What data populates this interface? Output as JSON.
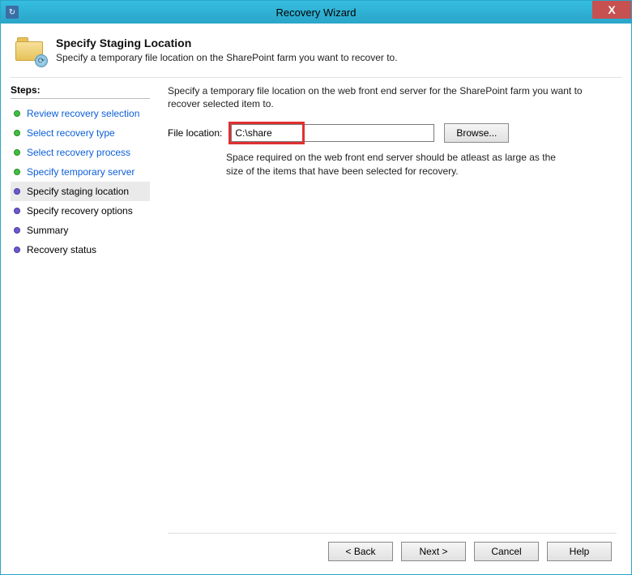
{
  "window": {
    "title": "Recovery Wizard"
  },
  "header": {
    "title": "Specify Staging Location",
    "subtitle": "Specify a temporary file location on the SharePoint farm you want to recover to."
  },
  "steps": {
    "title": "Steps:",
    "items": [
      {
        "label": "Review recovery selection",
        "state": "completed"
      },
      {
        "label": "Select recovery type",
        "state": "completed"
      },
      {
        "label": "Select recovery process",
        "state": "completed"
      },
      {
        "label": "Specify temporary server",
        "state": "completed"
      },
      {
        "label": "Specify staging location",
        "state": "current"
      },
      {
        "label": "Specify recovery options",
        "state": "future"
      },
      {
        "label": "Summary",
        "state": "future"
      },
      {
        "label": "Recovery status",
        "state": "future"
      }
    ]
  },
  "content": {
    "instruction": "Specify a temporary file location on the web front end server for the SharePoint farm you want to recover selected item to.",
    "file_location_label": "File location:",
    "file_location_value": "C:\\share",
    "browse_label": "Browse...",
    "hint": "Space required on the web front end server should be atleast as large as the size of the items that have been selected for recovery."
  },
  "footer": {
    "back": "< Back",
    "next": "Next >",
    "cancel": "Cancel",
    "help": "Help"
  }
}
